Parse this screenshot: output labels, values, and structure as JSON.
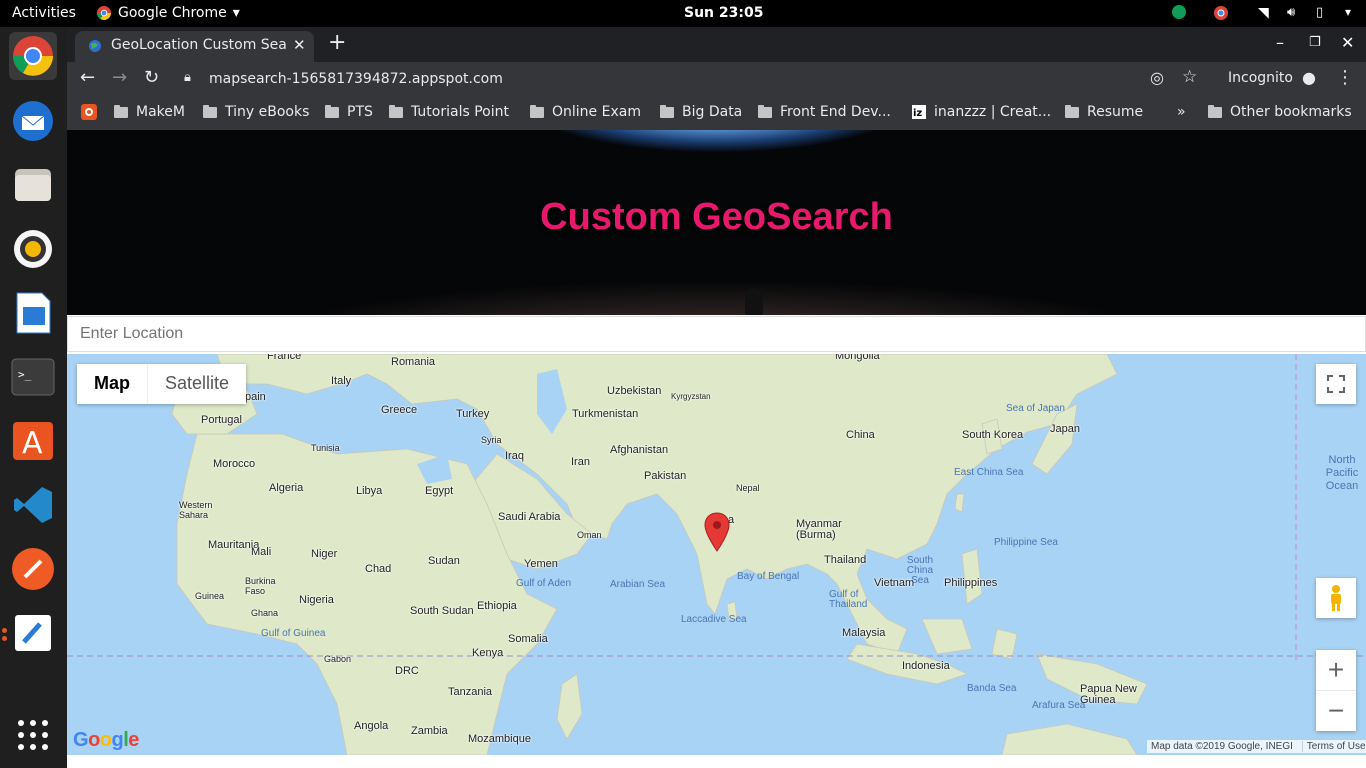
{
  "topbar": {
    "activities": "Activities",
    "app_menu": "Google Chrome",
    "clock": "Sun 23:05"
  },
  "browser": {
    "tab_title": "GeoLocation Custom Sear",
    "url": "mapsearch-1565817394872.appspot.com",
    "incognito": "Incognito",
    "bookmarks": [
      "MakeM",
      "Tiny eBooks",
      "PTS",
      "Tutorials Point",
      "Online Exam",
      "Big Data",
      "Front End Dev...",
      "inanzzz | Creat...",
      "Resume"
    ],
    "bookmarks_more": "»",
    "other_bookmarks": "Other bookmarks"
  },
  "page": {
    "title": "Custom GeoSearch",
    "search_placeholder": "Enter Location"
  },
  "map": {
    "map_button": "Map",
    "satellite_button": "Satellite",
    "attribution": "Map data ©2019 Google, INEGI",
    "terms": "Terms of Use",
    "logo": "Google",
    "labels": {
      "france": "France",
      "romania": "Romania",
      "mongolia": "Mongolia",
      "italy": "Italy",
      "spain": "pain",
      "uzbekistan": "Uzbekistan",
      "kyrgyzstan": "Kyrgyzstan",
      "greece": "Greece",
      "turkey": "Turkey",
      "turkmenistan": "Turkmenistan",
      "portugal": "Portugal",
      "china": "China",
      "south_korea": "South Korea",
      "japan": "Japan",
      "syria": "Syria",
      "tunisia": "Tunisia",
      "iraq": "Iraq",
      "afghanistan": "Afghanistan",
      "iran": "Iran",
      "morocco": "Morocco",
      "pakistan": "Pakistan",
      "nepal": "Nepal",
      "algeria": "Algeria",
      "libya": "Libya",
      "egypt": "Egypt",
      "western_sahara": "Western Sahara",
      "saudi_arabia": "Saudi Arabia",
      "india": "a",
      "oman": "Oman",
      "myanmar": "Myanmar (Burma)",
      "mauritania": "Mauritania",
      "mali": "Mali",
      "niger": "Niger",
      "sudan": "Sudan",
      "yemen": "Yemen",
      "chad": "Chad",
      "thailand": "Thailand",
      "burkina": "Burkina Faso",
      "vietnam": "Vietnam",
      "philippines": "Philippines",
      "guinea": "Guinea",
      "ghana": "Ghana",
      "nigeria": "Nigeria",
      "south_sudan": "South Sudan",
      "ethiopia": "Ethiopia",
      "somalia": "Somalia",
      "malaysia": "Malaysia",
      "gabon": "Gabon",
      "kenya": "Kenya",
      "drc": "DRC",
      "indonesia": "Indonesia",
      "tanzania": "Tanzania",
      "papua": "Papua New Guinea",
      "angola": "Angola",
      "zambia": "Zambia",
      "mozambique": "Mozambique"
    },
    "seas": {
      "sea_japan": "Sea of Japan",
      "east_china": "East China Sea",
      "north_pacific": "North Pacific Ocean",
      "philippine_sea": "Philippine Sea",
      "gulf_aden": "Gulf of Aden",
      "arabian_sea": "Arabian Sea",
      "bay_bengal": "Bay of Bengal",
      "south_china": "South China Sea",
      "gulf_thailand": "Gulf of Thailand",
      "laccadive": "Laccadive Sea",
      "gulf_guinea": "Gulf of Guinea",
      "banda": "Banda Sea",
      "arafura": "Arafura Sea"
    }
  },
  "colors": {
    "title": "#e8196c",
    "land": "#dfe9c9",
    "water": "#a9d3f5",
    "pin": "#e53935"
  }
}
